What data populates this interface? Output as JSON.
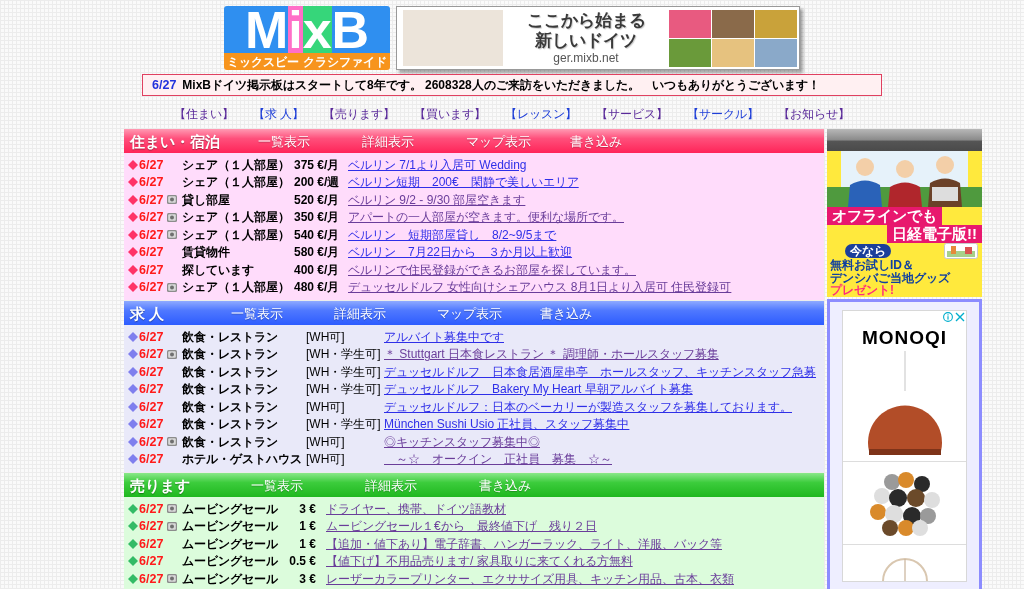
{
  "header": {
    "logo": {
      "wordmark": "MixB",
      "tagline": "ミックスビー クラシファイド"
    },
    "banner": {
      "headline": [
        "ここから始まる",
        "新しいドイツ"
      ],
      "url": "ger.mixb.net"
    }
  },
  "notice": {
    "date": "6/27",
    "message": "MixBドイツ掲示板はスタートして8年です。 2608328人のご来訪をいただきました。　いつもありがとうございます！"
  },
  "nav": [
    {
      "label": "【住まい】",
      "visited": true
    },
    {
      "label": "【求 人】",
      "visited": false
    },
    {
      "label": "【売ります】",
      "visited": true
    },
    {
      "label": "【買います】",
      "visited": true
    },
    {
      "label": "【レッスン】",
      "visited": false
    },
    {
      "label": "【サービス】",
      "visited": true
    },
    {
      "label": "【サークル】",
      "visited": false
    },
    {
      "label": "【お知らせ】",
      "visited": true
    }
  ],
  "sections": [
    {
      "kind": "housing",
      "title": "住まい・宿泊",
      "links": [
        "一覧表示",
        "詳細表示",
        "マップ表示",
        "書き込み"
      ],
      "rows": [
        {
          "date": "6/27",
          "photo": false,
          "category": "シェア（１人部屋）",
          "price": "375 €/月",
          "title": "ベルリン 7/1より入居可 Wedding",
          "visited": false
        },
        {
          "date": "6/27",
          "photo": false,
          "category": "シェア（１人部屋）",
          "price": "200 €/週",
          "title": "ベルリン短期　200€　閑静で美しいエリア",
          "visited": false
        },
        {
          "date": "6/27",
          "photo": true,
          "category": "貸し部屋",
          "price": "520 €/月",
          "title": "ベルリン 9/2 - 9/30 部屋空きます",
          "visited": true
        },
        {
          "date": "6/27",
          "photo": true,
          "category": "シェア（１人部屋）",
          "price": "350 €/月",
          "title": "アパートの一人部屋が空きます。便利な場所です。",
          "visited": true
        },
        {
          "date": "6/27",
          "photo": true,
          "category": "シェア（１人部屋）",
          "price": "540 €/月",
          "title": "ベルリン　短期部屋貸し　8/2~9/5まで",
          "visited": false
        },
        {
          "date": "6/27",
          "photo": false,
          "category": "賃貸物件",
          "price": "580 €/月",
          "title": "ベルリン　7月22日から　３か月以上歓迎",
          "visited": false
        },
        {
          "date": "6/27",
          "photo": false,
          "category": "探しています",
          "price": "400 €/月",
          "title": "ベルリンで住民登録ができるお部屋を探しています。",
          "visited": true
        },
        {
          "date": "6/27",
          "photo": true,
          "category": "シェア（１人部屋）",
          "price": "480 €/月",
          "title": "デュッセルドルフ 女性向けシェアハウス 8月1日より入居可 住民登録可",
          "visited": true
        }
      ]
    },
    {
      "kind": "jobs",
      "title": "求 人",
      "links": [
        "一覧表示",
        "詳細表示",
        "マップ表示",
        "書き込み"
      ],
      "rows": [
        {
          "date": "6/27",
          "photo": false,
          "category": "飲食・レストラン",
          "condition": "[WH可]",
          "title": "アルバイト募集中です",
          "visited": false
        },
        {
          "date": "6/27",
          "photo": true,
          "category": "飲食・レストラン",
          "condition": "[WH・学生可]",
          "title": "＊ Stuttgart 日本食レストラン ＊ 調理師・ホールスタッフ募集",
          "visited": true
        },
        {
          "date": "6/27",
          "photo": false,
          "category": "飲食・レストラン",
          "condition": "[WH・学生可]",
          "title": "デュッセルドルフ　日本食居酒屋串亭　ホールスタッフ、キッチンスタッフ急募",
          "visited": false
        },
        {
          "date": "6/27",
          "photo": false,
          "category": "飲食・レストラン",
          "condition": "[WH・学生可]",
          "title": "デュッセルドルフ　Bakery My Heart 早朝アルバイト募集",
          "visited": false
        },
        {
          "date": "6/27",
          "photo": false,
          "category": "飲食・レストラン",
          "condition": "[WH可]",
          "title": "デュッセルドルフ：日本のベーカリーが製造スタッフを募集しております。",
          "visited": false
        },
        {
          "date": "6/27",
          "photo": false,
          "category": "飲食・レストラン",
          "condition": "[WH・学生可]",
          "title": "München Sushi Usio 正社員、スタッフ募集中",
          "visited": false
        },
        {
          "date": "6/27",
          "photo": true,
          "category": "飲食・レストラン",
          "condition": "[WH可]",
          "title": "◎キッチンスタッフ募集中◎",
          "visited": true
        },
        {
          "date": "6/27",
          "photo": false,
          "category": "ホテル・ゲストハウス",
          "condition": "[WH可]",
          "title": "　～☆　オークイン　正社員　募集　☆～",
          "visited": true
        }
      ]
    },
    {
      "kind": "sale",
      "title": "売ります",
      "links": [
        "一覧表示",
        "詳細表示",
        "書き込み"
      ],
      "rows": [
        {
          "date": "6/27",
          "photo": true,
          "category": "ムービングセール",
          "price": "3 €",
          "title": "ドライヤー、携帯、ドイツ語教材",
          "visited": true
        },
        {
          "date": "6/27",
          "photo": true,
          "category": "ムービングセール",
          "price": "1 €",
          "title": "ムービングセール１€から　最終値下げ　残り２日",
          "visited": true
        },
        {
          "date": "6/27",
          "photo": false,
          "category": "ムービングセール",
          "price": "1 €",
          "title": "【追加・値下あり】電子辞書、ハンガーラック、ライト、洋服、バック等",
          "visited": true
        },
        {
          "date": "6/27",
          "photo": false,
          "category": "ムービングセール",
          "price": "0.5 €",
          "title": "【値下げ】不用品売ります/ 家具取りに来てくれる方無料",
          "visited": true
        },
        {
          "date": "6/27",
          "photo": true,
          "category": "ムービングセール",
          "price": "3 €",
          "title": "レーザーカラープリンター、エクササイズ用具、キッチン用品、古本、衣類",
          "visited": true
        }
      ]
    }
  ],
  "sidebar": {
    "promo": {
      "headline": [
        "オフラインでも",
        "日経電子版!!"
      ],
      "badge": "今なら",
      "offer": [
        "無料お試しID＆",
        "デンシバご当地グッズ"
      ],
      "cta": "プレゼント!"
    },
    "ad": {
      "brand": "MONOQI"
    }
  }
}
